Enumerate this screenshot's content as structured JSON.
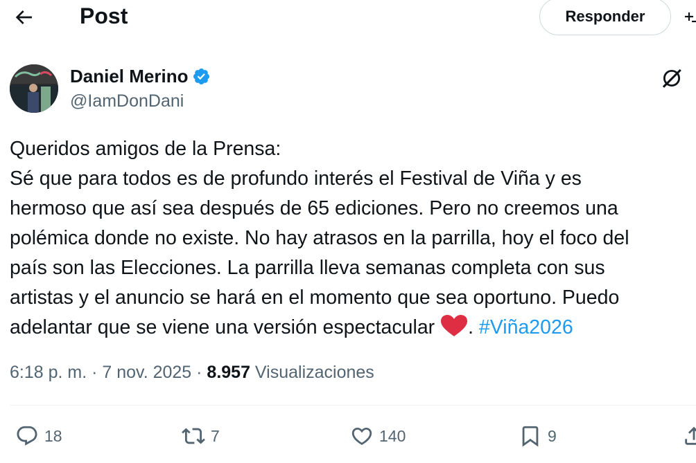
{
  "header": {
    "title": "Post",
    "reply_button": "Responder",
    "back_icon": "arrow-left-icon"
  },
  "author": {
    "name": "Daniel Merino",
    "handle": "@IamDonDani",
    "verified": true,
    "verified_color": "#1d9bf0"
  },
  "tweet": {
    "lines": [
      "Queridos amigos de la Prensa:",
      "Sé que para todos es de profundo interés el Festival de Viña y es",
      "hermoso que así sea después de 65 ediciones. Pero no creemos una",
      "polémica donde no existe. No hay atrasos en la parrilla, hoy el foco del",
      "país son las Elecciones. La parrilla lleva semanas completa con sus",
      "artistas y el anuncio se hará en el momento que sea oportuno. Puedo"
    ],
    "last_line": "adelantar que se viene una versión espectacular",
    "after_heart": ". ",
    "hashtag": "#Viña2026",
    "hashtag_color": "#1d9bf0"
  },
  "meta": {
    "time": "6:18 p. m.",
    "sep1": " · ",
    "date": "7 nov. 2025",
    "sep2": " · ",
    "views_count": "8.957",
    "views_label": " Visualizaciones"
  },
  "actions": {
    "replies": "18",
    "reposts": "7",
    "likes": "140",
    "bookmarks": "9"
  }
}
